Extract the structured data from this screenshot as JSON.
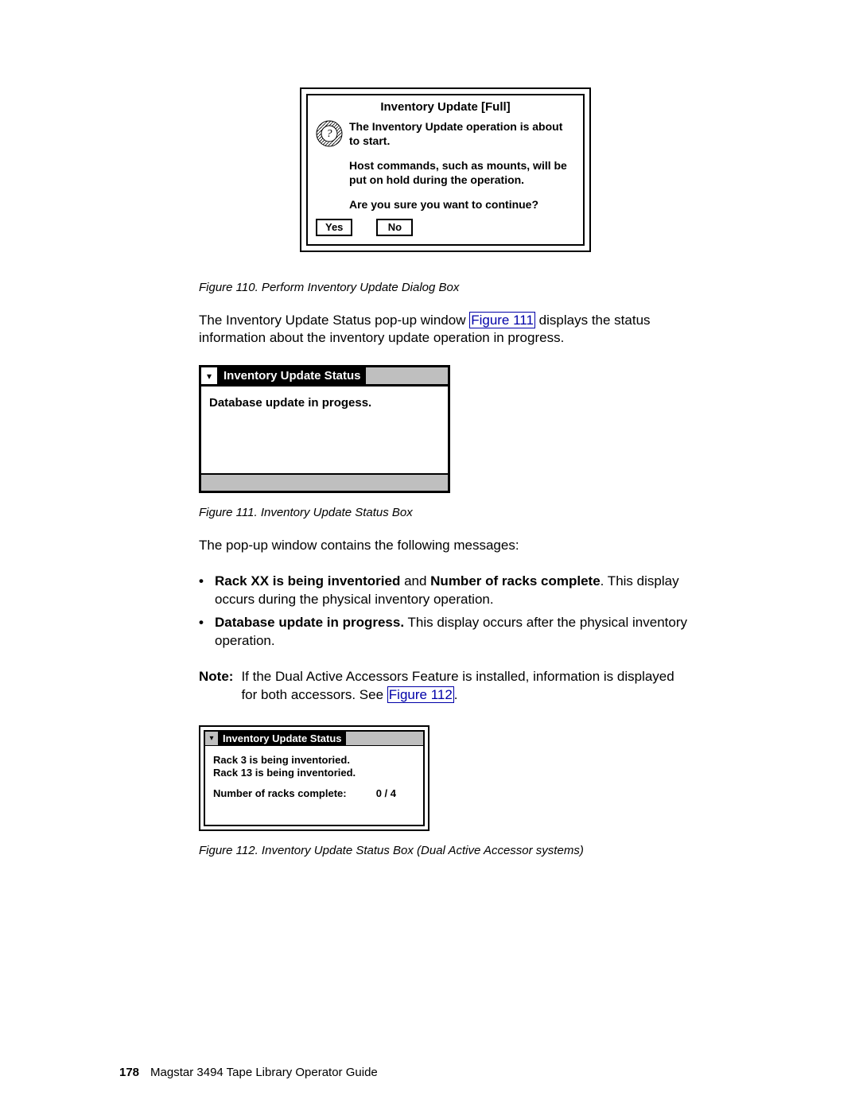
{
  "dialog1": {
    "title": "Inventory Update [Full]",
    "p1": "The Inventory Update operation is about to start.",
    "p2": "Host commands, such as mounts, will be put on hold during the operation.",
    "p3": "Are you sure you want to continue?",
    "yes": "Yes",
    "no": "No"
  },
  "caption1": "Figure 110. Perform Inventory Update Dialog Box",
  "para1a": "The Inventory Update Status pop-up window ",
  "link1": "Figure 111",
  "para1b": " displays the status information about the inventory update operation in progress.",
  "dialog2": {
    "title": "Inventory Update Status",
    "body": "Database update in progess."
  },
  "caption2": "Figure 111. Inventory Update Status Box",
  "para2": "The pop-up window contains the following messages:",
  "bullet1_b1": "Rack XX is being inventoried",
  "bullet1_mid": " and ",
  "bullet1_b2": "Number of racks complete",
  "bullet1_tail": ". This display occurs during the physical inventory operation.",
  "bullet2_b": "Database update in progress.",
  "bullet2_tail": " This display occurs after the physical inventory operation.",
  "note_label": "Note:",
  "note_a": "If the Dual Active Accessors Feature is installed, information is displayed for both accessors. See ",
  "link2": "Figure 112",
  "note_b": ".",
  "dialog3": {
    "title": "Inventory Update Status",
    "line1": "Rack 3 is being inventoried.",
    "line2": "Rack 13 is being inventoried.",
    "racks_label": "Number of racks complete:",
    "racks_value": "0 / 4"
  },
  "caption3": "Figure 112. Inventory Update Status Box (Dual Active Accessor systems)",
  "footer": {
    "page": "178",
    "title": "Magstar 3494 Tape Library Operator Guide"
  }
}
